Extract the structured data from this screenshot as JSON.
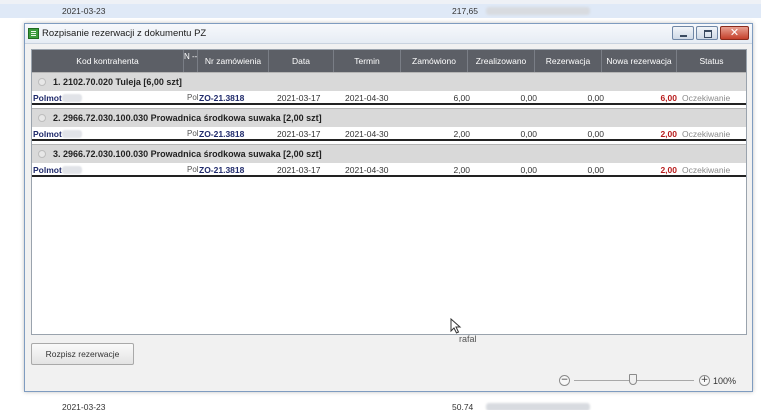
{
  "background": {
    "top_row": {
      "date": "2021-03-23",
      "value": "217,65"
    },
    "bottom_row": {
      "date": "2021-03-23",
      "value": "50.74"
    }
  },
  "window": {
    "title": "Rozpisanie rezerwacji z dokumentu PZ",
    "close_glyph": "✕"
  },
  "grid": {
    "columns": [
      "Kod kontrahenta",
      "N --",
      "Nr zamówienia",
      "Data",
      "Termin",
      "Zamówiono",
      "Zrealizowano",
      "Rezerwacja",
      "Nowa rezerwacja",
      "Status"
    ],
    "groups": [
      {
        "title": "1. 2102.70.020 Tuleja [6,00 szt]",
        "row": {
          "kod": "Polmot",
          "n": "Pol",
          "nr": "ZO-21.3818",
          "data": "2021-03-17",
          "termin": "2021-04-30",
          "zamowiono": "6,00",
          "zrealizowano": "0,00",
          "rezerwacja": "0,00",
          "nowa": "6,00",
          "status": "Oczekiwanie"
        }
      },
      {
        "title": "2. 2966.72.030.100.030 Prowadnica środkowa suwaka [2,00 szt]",
        "row": {
          "kod": "Polmot",
          "n": "Pol",
          "nr": "ZO-21.3818",
          "data": "2021-03-17",
          "termin": "2021-04-30",
          "zamowiono": "2,00",
          "zrealizowano": "0,00",
          "rezerwacja": "0,00",
          "nowa": "2,00",
          "status": "Oczekiwanie"
        }
      },
      {
        "title": "3. 2966.72.030.100.030 Prowadnica środkowa suwaka [2,00 szt]",
        "row": {
          "kod": "Polmot",
          "n": "Pol",
          "nr": "ZO-21.3818",
          "data": "2021-03-17",
          "termin": "2021-04-30",
          "zamowiono": "2,00",
          "zrealizowano": "0,00",
          "rezerwacja": "0,00",
          "nowa": "2,00",
          "status": "Oczekiwanie"
        }
      }
    ],
    "watermark": "rafal"
  },
  "actions": {
    "split_label": "Rozpisz rezerwacje"
  },
  "zoom": {
    "out_glyph": "−",
    "in_glyph": "+",
    "label": "100%",
    "level": 100
  },
  "colors": {
    "header_bg": "#5c5f66",
    "accent_red": "#b81c1c",
    "link_blue": "#1f2a6b"
  }
}
